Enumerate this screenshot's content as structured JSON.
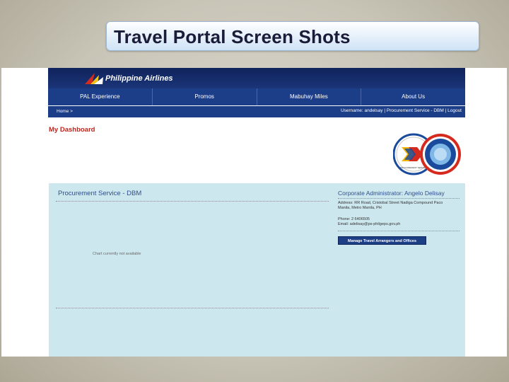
{
  "slide": {
    "title": "Travel Portal Screen Shots"
  },
  "site": {
    "logo_text": "Philippine Airlines",
    "nav": [
      "PAL Experience",
      "Promos",
      "Mabuhay Miles",
      "About Us"
    ],
    "breadcrumb": "Home >",
    "user": {
      "prefix": "Username: andelsay",
      "separator": " | ",
      "service": "Procurement Service - DBM",
      "logout": "Logout"
    },
    "dashboard_title": "My Dashboard",
    "seal_label": "PROCUREMENT SERVICE"
  },
  "panel": {
    "agency": "Procurement Service - DBM",
    "chart_message": "Chart currently not available",
    "admin_title": "Corporate Administrator: Angelo Delisay",
    "address_line1": "Address: RR Road, Cristobal Street Nadiga Compound Paco",
    "address_line2": "Manila, Metro Manila, PH",
    "phone": "Phone: 2 6406505",
    "email": "Email: adelisay@ps-philgeps.gov.ph",
    "manage_button": "Manage Travel Arrangers and Offices"
  },
  "colors": {
    "nav_bg": "#1c3d87",
    "panel_bg": "#cde7ef",
    "dashboard_title": "#c0241b",
    "title_box": "#e9f2fb"
  }
}
